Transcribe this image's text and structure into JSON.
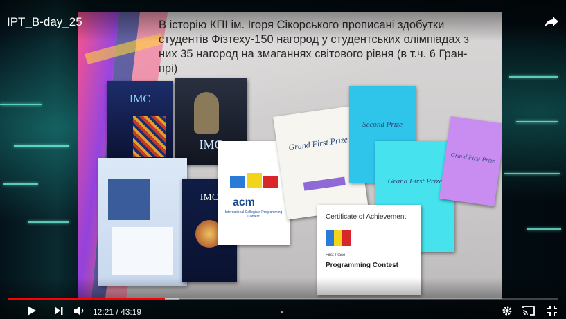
{
  "video": {
    "title": "IPT_B-day_25",
    "current_time": "12:21",
    "separator": "/",
    "duration": "43:19",
    "progress": 0.285,
    "buffered": 0.31
  },
  "slide": {
    "text": "В історію КПІ ім. Ігоря Сікорського прописані здобутки студентів Фізтеху-150 нагород у студентських олімпіадах з них 35 нагород на змаганнях світового рівня (в т.ч. 6 Гран-прі)"
  },
  "documents": {
    "imc_2003": "IMC",
    "imc_2007": "IMC",
    "imc_2004": "IMC",
    "acm_logo": "acm",
    "acm_caption": "International Collegiate Programming Contest",
    "grand_first_prize": "Grand First Prize",
    "second_prize": "Second Prize",
    "certificate_title": "Certificate of Achievement",
    "programming_contest": "Programming Contest",
    "first_place": "First Place"
  },
  "colors": {
    "progress": "#ff0000",
    "accent_teal": "#2ad0c4"
  },
  "icons": {
    "play": "play-icon",
    "next": "next-icon",
    "volume": "volume-icon",
    "settings": "gear-icon",
    "cast": "cast-icon",
    "exit_fullscreen": "exit-fullscreen-icon",
    "share": "share-icon"
  }
}
